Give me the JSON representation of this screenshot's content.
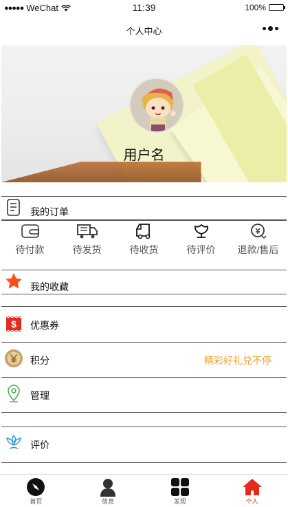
{
  "status_bar": {
    "carrier": "WeChat",
    "time": "11:39",
    "battery": "100%",
    "battery_level": 1.0
  },
  "nav": {
    "title": "个人中心"
  },
  "profile": {
    "username": "用户名"
  },
  "orders": {
    "title": "我的订单",
    "tabs": [
      {
        "label": "待付款",
        "icon": "wallet-icon"
      },
      {
        "label": "待发货",
        "icon": "truck-icon"
      },
      {
        "label": "待收货",
        "icon": "delivery-van-icon"
      },
      {
        "label": "待评价",
        "icon": "tulip-icon"
      },
      {
        "label": "退款/售后",
        "icon": "refund-icon"
      }
    ]
  },
  "menu": {
    "favorites": {
      "label": "我的收藏",
      "icon": "star-icon",
      "color": "#ff4d1a"
    },
    "coupons": {
      "label": "优惠券",
      "icon": "coupon-icon",
      "color": "#e02b1e"
    },
    "points": {
      "label": "积分",
      "icon": "yen-coin-icon",
      "extra": "精彩好礼兑不停",
      "extra_color": "#f0a030"
    },
    "manage": {
      "label": "管理",
      "icon": "location-pin-icon",
      "color": "#4caf50"
    },
    "review": {
      "label": "评价",
      "icon": "lotus-icon",
      "color": "#2a9fd6"
    }
  },
  "tab_bar": {
    "items": [
      {
        "label": "首页",
        "icon": "compass-icon"
      },
      {
        "label": "信息",
        "icon": "person-icon"
      },
      {
        "label": "发现",
        "icon": "grid-icon"
      },
      {
        "label": "个人",
        "icon": "home-icon",
        "active": true
      }
    ],
    "active_color": "#e02b1e"
  }
}
